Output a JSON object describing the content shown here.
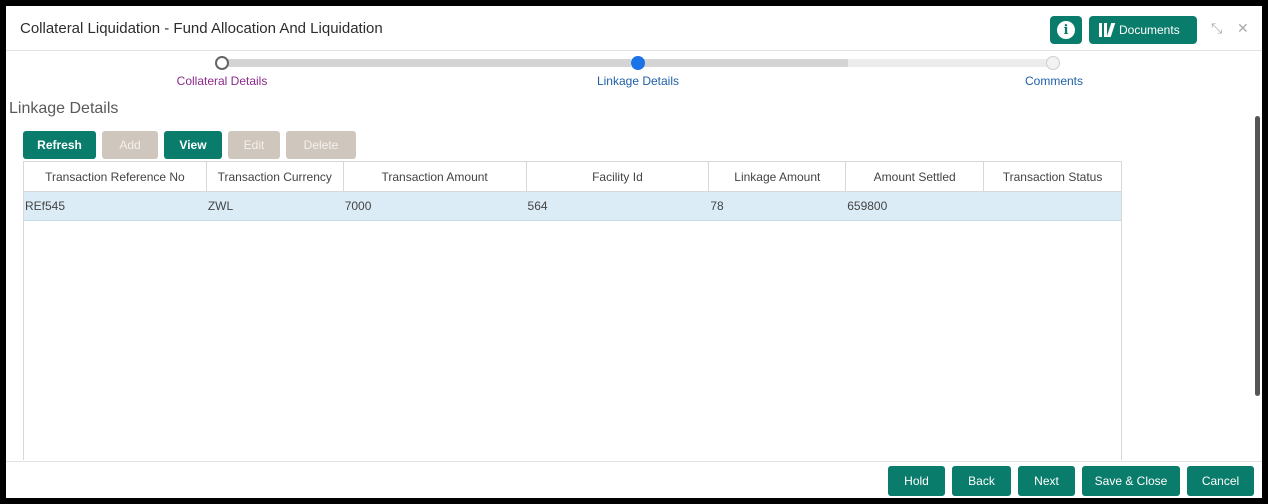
{
  "window": {
    "title": "Collateral Liquidation - Fund Allocation And Liquidation",
    "info_icon_glyph": "i",
    "documents_label": "Documents",
    "minimize_glyph": "⤡",
    "close_glyph": "✕"
  },
  "colors": {
    "accent": "#0a7c6b",
    "disabled_button": "#cfc6bd",
    "step_done_label": "#8a2a8a",
    "step_active": "#1a73e8",
    "selected_row": "#dcecf7"
  },
  "stepper": {
    "steps": [
      {
        "label": "Collateral Details",
        "state": "completed"
      },
      {
        "label": "Linkage Details",
        "state": "active"
      },
      {
        "label": "Comments",
        "state": "pending"
      }
    ]
  },
  "section": {
    "title": "Linkage Details"
  },
  "toolbar": {
    "buttons": [
      {
        "label": "Refresh",
        "enabled": true
      },
      {
        "label": "Add",
        "enabled": false
      },
      {
        "label": "View",
        "enabled": true
      },
      {
        "label": "Edit",
        "enabled": false
      },
      {
        "label": "Delete",
        "enabled": false
      }
    ]
  },
  "table": {
    "columns": [
      "Transaction Reference No",
      "Transaction Currency",
      "Transaction Amount",
      "Facility Id",
      "Linkage Amount",
      "Amount Settled",
      "Transaction Status"
    ],
    "rows": [
      [
        "REf545",
        "ZWL",
        "7000",
        "564",
        "78",
        "659800",
        ""
      ]
    ]
  },
  "footer": {
    "buttons": [
      "Hold",
      "Back",
      "Next",
      "Save & Close",
      "Cancel"
    ]
  }
}
